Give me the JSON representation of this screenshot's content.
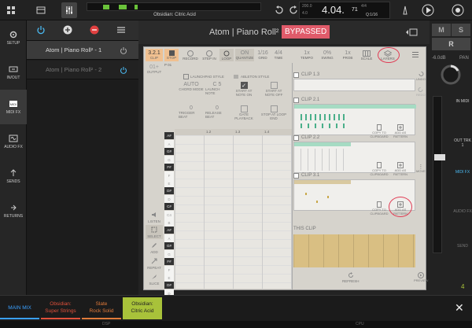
{
  "topbar": {
    "clip_name": "Obsidian: Citric Acid",
    "time": "4.04.",
    "time_small": "71",
    "position_small": "200.0",
    "beats": "4.0",
    "signature": "4/4",
    "quantize": "Q:1/16"
  },
  "leftnav": {
    "items": [
      {
        "label": "SETUP",
        "icon": "gear-icon"
      },
      {
        "label": "IN/OUT",
        "icon": "io-icon"
      },
      {
        "label": "MIDI FX",
        "icon": "midi-icon"
      },
      {
        "label": "AUDIO FX",
        "icon": "audio-fx-icon"
      },
      {
        "label": "SENDS",
        "icon": "sends-icon"
      },
      {
        "label": "RETURNS",
        "icon": "returns-icon"
      }
    ]
  },
  "plugins": [
    {
      "name": "Atom | Piano Roll² - 1"
    },
    {
      "name": "Atom | Piano Roll² - 2"
    }
  ],
  "plugin_window": {
    "title": "Atom | Piano Roll²",
    "bypass": "BYPASSED"
  },
  "toolbar": {
    "clip_num": "3.2.1",
    "clip": "CLIP",
    "stop": "STOP",
    "record": "RECORD",
    "step_in": "STEP IN",
    "loop": "LOOP",
    "quantize_val": "ON",
    "quantize": "QUANTIZE",
    "grid_val": "1/16",
    "grid": "GRID",
    "time_val": "4/4",
    "time": "TIME",
    "tempo_val": "1x",
    "tempo": "TEMPO",
    "swing_val": "0%",
    "swing": "SWING",
    "prob_val": "1x",
    "prob": "PROB",
    "scale": "SCALE",
    "layers": "LAYERS"
  },
  "left_panel": {
    "output_val": "01+",
    "output": "OUTPUT",
    "p01": "P 01",
    "listen": "LISTEN",
    "select": "SELECT",
    "add": "ADD",
    "repeat": "REPEAT",
    "slice": "SLICE"
  },
  "controls": {
    "launchpad_style": "LAUNCHPAD STYLE",
    "ableton_style": "ABLETON STYLE",
    "chord_val": "AUTO",
    "chord": "CHORD MODE",
    "launch_val": "C 5",
    "launch": "LAUNCH NOTE",
    "start_at_note_on": "START AT NOTE ON",
    "start_at_note_off": "START AT NOTE OFF",
    "trigger_val": "0",
    "trigger": "TRIGGER BEAT",
    "release_val": "0",
    "release": "RELEASE BEAT",
    "gate": "GATE PLAYBACK",
    "stop_loop": "STOP AT LOOP END"
  },
  "keys": [
    "A#",
    "A",
    "G#",
    "G",
    "F#",
    "F",
    "E",
    "D#",
    "D",
    "C#",
    "C4",
    "B",
    "A#",
    "A",
    "G#",
    "G",
    "F#",
    "F",
    "E",
    "D#",
    "D",
    "C#",
    "C3"
  ],
  "ruler": [
    "1.2",
    "1.3",
    "1.4"
  ],
  "clips": [
    {
      "name": "CLIP 1.3"
    },
    {
      "name": "CLIP 2.1"
    },
    {
      "name": "CLIP 2.2"
    },
    {
      "name": "CLIP 3.1"
    }
  ],
  "clip_actions": {
    "copy": "COPY TO CLIPBOARD",
    "add_pattern": "ADD AS PATTERN",
    "this_clip": "THIS CLIP",
    "refresh": "REFRESH",
    "undo": "UNDO",
    "redo": "REDO",
    "move": "MOVE",
    "preview": "PREVIEW"
  },
  "mixer": {
    "m": "M",
    "s": "S",
    "r": "R",
    "level": "-6.0dB",
    "pan": "PAN",
    "in_midi": "IN MIDI",
    "out_trk": "OUT TRK 1",
    "midi_fx": "MIDI FX",
    "audio_fx": "AUDIO FX",
    "send": "SEND",
    "number": "4"
  },
  "bottom_tabs": [
    {
      "line1": "MAIN MIX",
      "line2": "",
      "color": "#3aa0ff"
    },
    {
      "line1": "Obsidian:",
      "line2": "Super Strings",
      "color": "#e0503a"
    },
    {
      "line1": "Slate",
      "line2": "Rock Solid",
      "color": "#e07a3a"
    },
    {
      "line1": "Obsidian:",
      "line2": "Citric Acid",
      "color": "#a8c23a"
    }
  ],
  "status": {
    "left": "DSP",
    "right": "CPU"
  }
}
